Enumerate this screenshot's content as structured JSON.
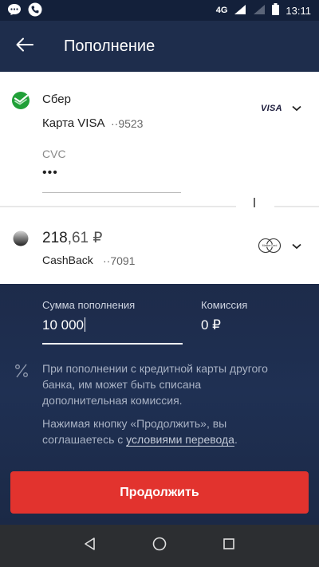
{
  "status_bar": {
    "network": "4G",
    "time": "13:11"
  },
  "header": {
    "title": "Пополнение",
    "back_icon": "arrow-left-icon"
  },
  "source": {
    "bank": "Сбер",
    "card_name": "Карта VISA",
    "card_number": "··9523",
    "payment_system": "VISA",
    "cvc_label": "CVC",
    "cvc_value": "•••"
  },
  "destination": {
    "balance_int": "218",
    "balance_frac": ",61 ₽",
    "card_name": "CashBack",
    "card_number": "··7091",
    "payment_system": "MasterCard"
  },
  "form": {
    "amount_label": "Сумма пополнения",
    "amount_value": "10 000",
    "fee_label": "Комиссия",
    "fee_value": "0 ₽",
    "note": "При пополнении с кредитной карты другого банка, им может быть списана дополнительная комиссия.",
    "terms_prefix": "Нажимая кнопку «Продолжить», вы соглашаетесь с ",
    "terms_link": "условиями перевода",
    "terms_suffix": ".",
    "continue_label": "Продолжить"
  },
  "colors": {
    "accent": "#e2332e",
    "header_bg": "#1e2d4c",
    "sber_green": "#21a038"
  }
}
